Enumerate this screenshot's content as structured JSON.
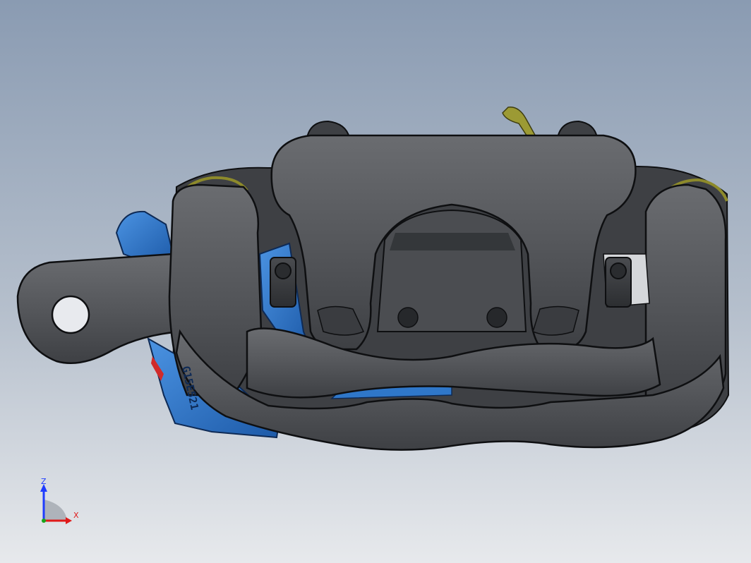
{
  "viewport": {
    "background_top": "#8a9bb2",
    "background_bottom": "#e7e9ec"
  },
  "model": {
    "part_marking": "G15E521",
    "colors": {
      "housing": "#4b4d51",
      "housing_edge": "#0e0f11",
      "pad_bracket": "#2f77c9",
      "spring": "#8d8a2b"
    }
  },
  "triad": {
    "z_label": "Z",
    "x_label": "X",
    "z_color": "#1f3cff",
    "x_color": "#e01a1a",
    "y_color": "#1aa51a"
  }
}
